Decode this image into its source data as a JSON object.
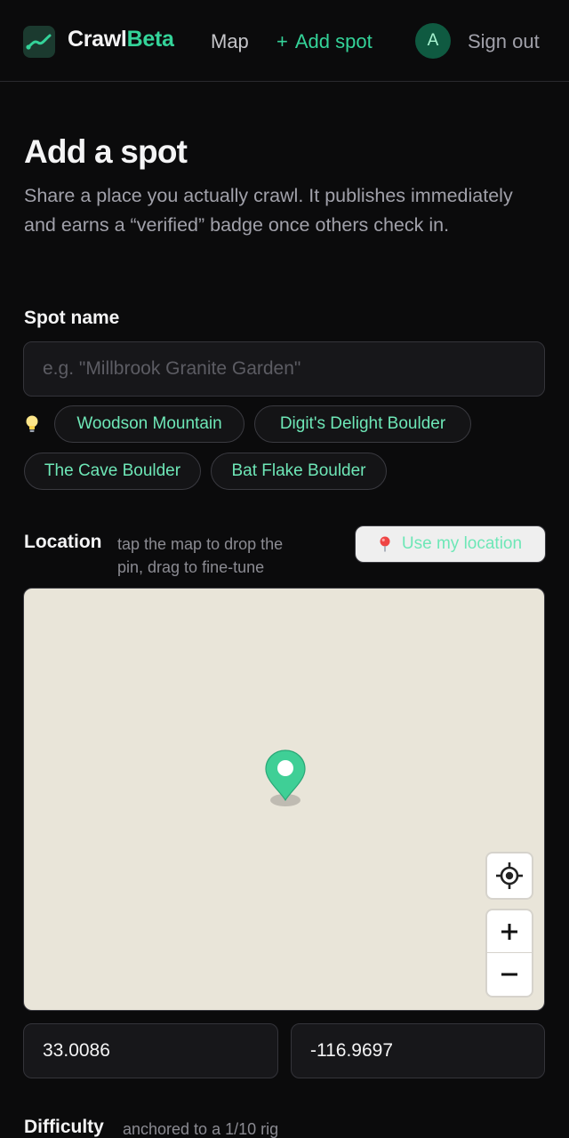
{
  "nav": {
    "brand_main": "Crawl",
    "brand_accent": "Beta",
    "map_label": "Map",
    "add_plus": "+",
    "add_label": "Add spot",
    "avatar_initial": "A",
    "signout_label": "Sign out"
  },
  "page": {
    "title": "Add a spot",
    "intro": "Share a place you actually crawl. It publishes immediately and earns a “verified” badge once others check in."
  },
  "spot_name": {
    "label": "Spot name",
    "placeholder": "e.g. \"Millbrook Granite Garden\"",
    "value": "",
    "suggestions": [
      "Woodson Mountain",
      "Digit's Delight Boulder",
      "The Cave Boulder",
      "Bat Flake Boulder"
    ]
  },
  "location": {
    "label": "Location",
    "hint_line1": "tap the map to drop the",
    "hint_line2": "pin, drag to fine-tune",
    "use_my_location": "Use my location",
    "latitude": "33.0086",
    "longitude": "-116.9697"
  },
  "difficulty": {
    "label": "Difficulty",
    "hint": "anchored to a 1/10 rig"
  },
  "icons": {
    "logo": "trend-line-icon",
    "bulb": "lightbulb-icon",
    "location_pin": "red-pin-icon",
    "map_pin": "map-pin-icon",
    "locate": "crosshair-icon",
    "zoom_in": "plus-icon",
    "zoom_out": "minus-icon"
  },
  "colors": {
    "accent": "#34d399",
    "background": "#0b0b0c",
    "map_bg": "#e9e5d9",
    "pin": "#3fcf96"
  }
}
